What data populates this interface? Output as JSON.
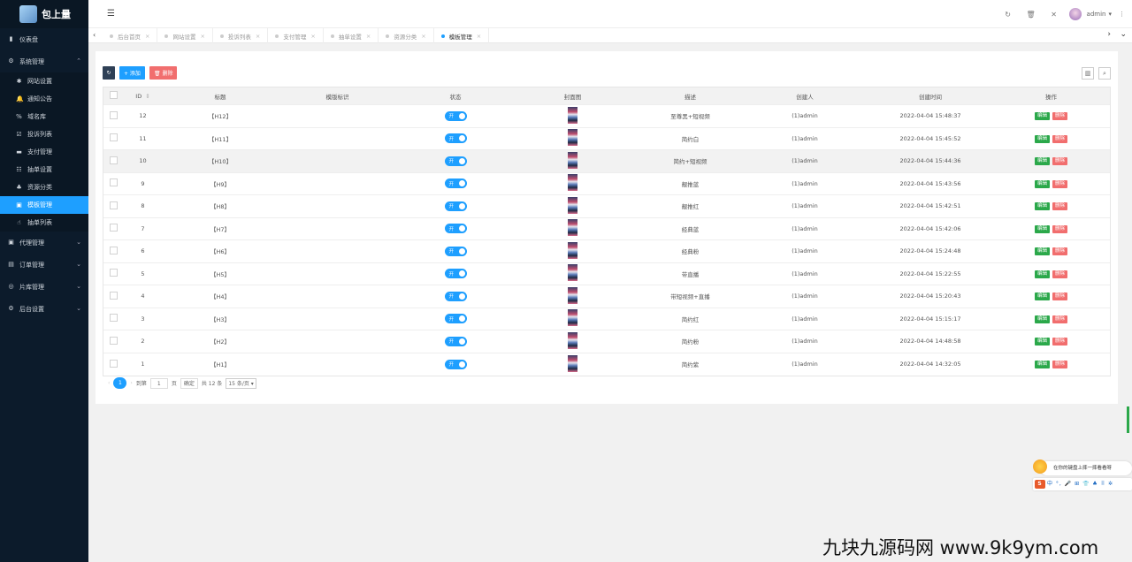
{
  "brand": {
    "name": "包上量"
  },
  "sidebar": {
    "top": [
      {
        "label": "仪表盘",
        "icon": "dashboard-icon"
      },
      {
        "label": "系统管理",
        "icon": "gear-icon",
        "arrow": "⌃"
      }
    ],
    "sub": [
      {
        "label": "网站设置",
        "icon": "gear-icon",
        "g": "✱"
      },
      {
        "label": "通知公告",
        "icon": "bell-icon",
        "g": "🔔"
      },
      {
        "label": "域名库",
        "icon": "link-icon",
        "g": "%"
      },
      {
        "label": "投诉列表",
        "icon": "check-square-icon",
        "g": "☑"
      },
      {
        "label": "支付管理",
        "icon": "card-icon",
        "g": "▬"
      },
      {
        "label": "抽单设置",
        "icon": "bank-icon",
        "g": "☷"
      },
      {
        "label": "资源分类",
        "icon": "tree-icon",
        "g": "♣"
      },
      {
        "label": "模板管理",
        "icon": "template-icon",
        "g": "▣",
        "active": true
      },
      {
        "label": "抽单列表",
        "icon": "hand-icon",
        "g": "☝"
      }
    ],
    "bottom": [
      {
        "label": "代理管理",
        "icon": "agent-icon",
        "g": "▣"
      },
      {
        "label": "订单管理",
        "icon": "order-icon",
        "g": "▤"
      },
      {
        "label": "片库管理",
        "icon": "film-icon",
        "g": "◎"
      },
      {
        "label": "后台设置",
        "icon": "settings-icon",
        "g": "⚙"
      }
    ]
  },
  "topbar": {
    "menu_glyph": "☰",
    "user": "admin",
    "user_arrow": "▾",
    "more": "⋮",
    "tool_glyphs": [
      "↻",
      "🗑",
      "✕"
    ]
  },
  "tabs": [
    {
      "label": "后台首页"
    },
    {
      "label": "网站设置"
    },
    {
      "label": "投诉列表"
    },
    {
      "label": "支付管理"
    },
    {
      "label": "抽单设置"
    },
    {
      "label": "资源分类"
    },
    {
      "label": "模板管理",
      "active": true
    }
  ],
  "toolbar": {
    "refresh": "↻",
    "add": "+ 添加",
    "delete": "🗑 删除"
  },
  "table": {
    "headers": [
      "",
      "ID",
      "标题",
      "模版标识",
      "状态",
      "封面图",
      "描述",
      "创建人",
      "创建时间",
      "操作"
    ],
    "id_sort": "⇕",
    "switch_label": "开",
    "edit": "编辑",
    "del": "删除",
    "rows": [
      {
        "id": "12",
        "title": "【H12】",
        "key": "",
        "desc": "至尊黑+短视频",
        "creator": "(1)admin",
        "time": "2022-04-04 15:48:37"
      },
      {
        "id": "11",
        "title": "【H11】",
        "key": "",
        "desc": "简约白",
        "creator": "(1)admin",
        "time": "2022-04-04 15:45:52"
      },
      {
        "id": "10",
        "title": "【H10】",
        "key": "",
        "desc": "简约+短视频",
        "creator": "(1)admin",
        "time": "2022-04-04 15:44:36",
        "hl": true
      },
      {
        "id": "9",
        "title": "【H9】",
        "key": "",
        "desc": "靓推蓝",
        "creator": "(1)admin",
        "time": "2022-04-04 15:43:56"
      },
      {
        "id": "8",
        "title": "【H8】",
        "key": "",
        "desc": "靓推红",
        "creator": "(1)admin",
        "time": "2022-04-04 15:42:51"
      },
      {
        "id": "7",
        "title": "【H7】",
        "key": "",
        "desc": "经典蓝",
        "creator": "(1)admin",
        "time": "2022-04-04 15:42:06"
      },
      {
        "id": "6",
        "title": "【H6】",
        "key": "",
        "desc": "经典粉",
        "creator": "(1)admin",
        "time": "2022-04-04 15:24:48"
      },
      {
        "id": "5",
        "title": "【H5】",
        "key": "",
        "desc": "带直播",
        "creator": "(1)admin",
        "time": "2022-04-04 15:22:55"
      },
      {
        "id": "4",
        "title": "【H4】",
        "key": "",
        "desc": "带短视频+直播",
        "creator": "(1)admin",
        "time": "2022-04-04 15:20:43"
      },
      {
        "id": "3",
        "title": "【H3】",
        "key": "",
        "desc": "简约红",
        "creator": "(1)admin",
        "time": "2022-04-04 15:15:17"
      },
      {
        "id": "2",
        "title": "【H2】",
        "key": "",
        "desc": "简约粉",
        "creator": "(1)admin",
        "time": "2022-04-04 14:48:58"
      },
      {
        "id": "1",
        "title": "【H1】",
        "key": "",
        "desc": "简约紫",
        "creator": "(1)admin",
        "time": "2022-04-04 14:32:05"
      }
    ]
  },
  "pager": {
    "prev": "‹",
    "current": "1",
    "next": "›",
    "goto": "到第",
    "page_input": "1",
    "page_unit": "页",
    "confirm": "确定",
    "total": "共 12 条",
    "per_page": "15 条/页 ▾"
  },
  "ime": {
    "hint": "在你的键盘上摔一摔看看呀",
    "bar": "中 °, 🎤 ⊞ 👕 ♣ ⠿ ✲"
  },
  "watermark": "九块九源码网 www.9k9ym.com"
}
